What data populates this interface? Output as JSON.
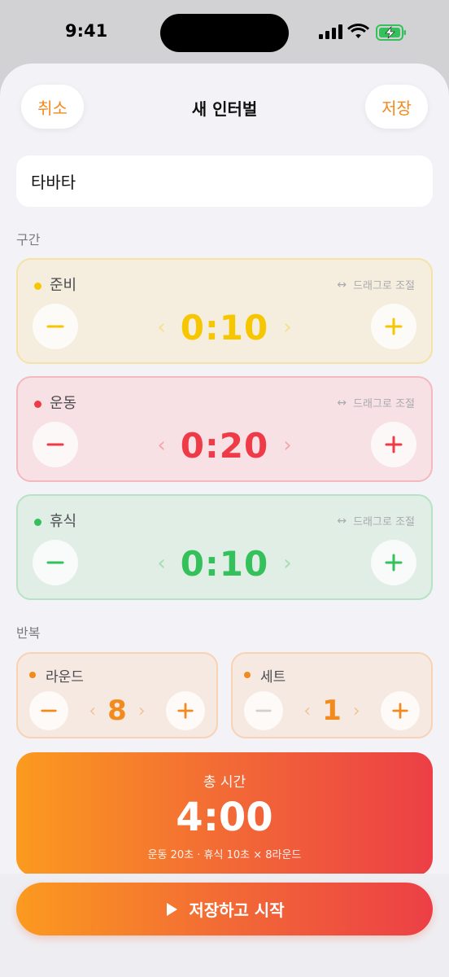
{
  "status_bar": {
    "time": "9:41"
  },
  "nav": {
    "cancel_label": "취소",
    "title": "새 인터벌",
    "save_label": "저장"
  },
  "name_field": {
    "value": "타바타"
  },
  "sections": {
    "segments_label": "구간",
    "repeat_label": "반복"
  },
  "segments": [
    {
      "name": "준비",
      "value": "0:10",
      "hint": "드래그로 조절",
      "color": "#f6c700",
      "bg": "#f5eede",
      "border": "#f5e2a6"
    },
    {
      "name": "운동",
      "value": "0:20",
      "hint": "드래그로 조절",
      "color": "#ef3b48",
      "bg": "#f8e1e4",
      "border": "#f4b9c0"
    },
    {
      "name": "휴식",
      "value": "0:10",
      "hint": "드래그로 조절",
      "color": "#34c05a",
      "bg": "#e1eee6",
      "border": "#b7e3c5"
    }
  ],
  "repeat": {
    "rounds": {
      "name": "라운드",
      "value": "8"
    },
    "sets": {
      "name": "세트",
      "value": "1"
    }
  },
  "total": {
    "label": "총 시간",
    "value": "4:00",
    "detail": "운동 20초 · 휴식 10초 × 8라운드"
  },
  "start_button": {
    "label": "저장하고 시작"
  },
  "colors": {
    "accent": "#f28a1e",
    "gradient_start": "#fb9a1f",
    "gradient_end": "#ec3f46"
  }
}
